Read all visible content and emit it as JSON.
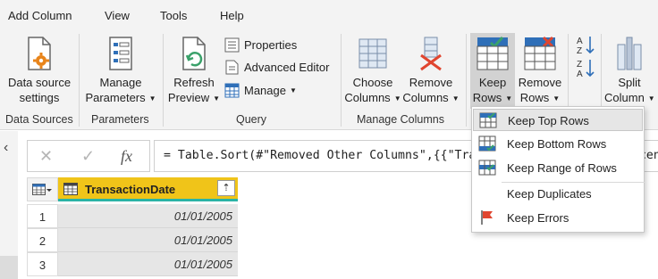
{
  "tabs": [
    "Add Column",
    "View",
    "Tools",
    "Help"
  ],
  "ribbon": {
    "data_sources": {
      "button": [
        "Data source",
        "settings"
      ],
      "group": "Data Sources"
    },
    "parameters": {
      "button": [
        "Manage",
        "Parameters"
      ],
      "group": "Parameters"
    },
    "query": {
      "refresh": [
        "Refresh",
        "Preview"
      ],
      "properties": "Properties",
      "advanced_editor": "Advanced Editor",
      "manage": "Manage",
      "group": "Query"
    },
    "manage_columns": {
      "choose": [
        "Choose",
        "Columns"
      ],
      "remove": [
        "Remove",
        "Columns"
      ],
      "group": "Manage Columns"
    },
    "keep_rows": [
      "Keep",
      "Rows"
    ],
    "remove_rows": [
      "Remove",
      "Rows"
    ],
    "split_column": [
      "Split",
      "Column"
    ]
  },
  "formula_bar": {
    "cancel": "✕",
    "commit": "✓",
    "fx": "fx",
    "formula": "= Table.Sort(#\"Removed Other Columns\",{{\"TransactionDate\", Order.Ascending}})"
  },
  "table": {
    "column": "TransactionDate",
    "rows": [
      {
        "num": "1",
        "value": "01/01/2005"
      },
      {
        "num": "2",
        "value": "01/01/2005"
      },
      {
        "num": "3",
        "value": "01/01/2005"
      }
    ]
  },
  "menu": {
    "items": [
      "Keep Top Rows",
      "Keep Bottom Rows",
      "Keep Range of Rows",
      "Keep Duplicates",
      "Keep Errors"
    ],
    "highlighted": "Keep Top Rows"
  },
  "colors": {
    "accent_yellow": "#f0c419",
    "teal": "#2ab3a6",
    "red": "#e0452f",
    "blue": "#2f6fb8",
    "green": "#3aa16a"
  }
}
